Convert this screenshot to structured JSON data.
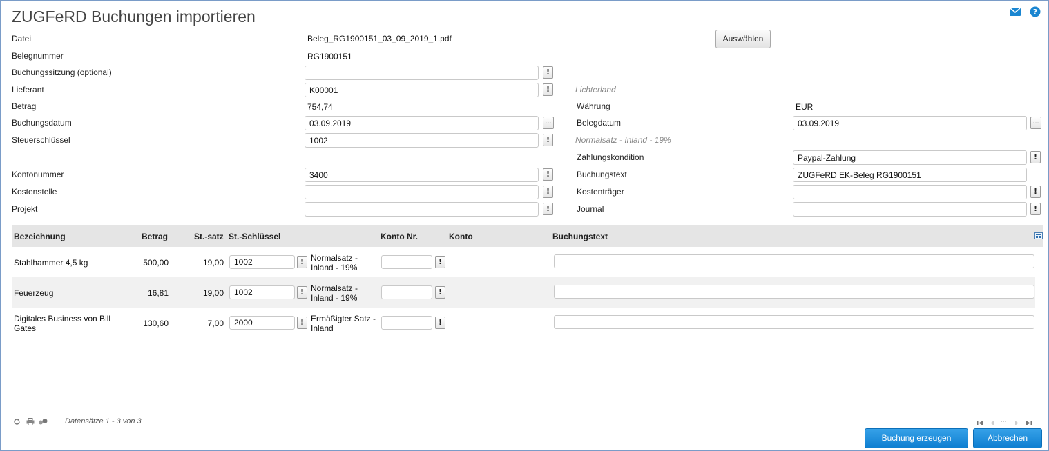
{
  "title": "ZUGFeRD Buchungen importieren",
  "icons": {
    "mail": "mail-icon",
    "help": "help-icon"
  },
  "form": {
    "datei": {
      "label": "Datei",
      "value": "Beleg_RG1900151_03_09_2019_1.pdf",
      "button": "Auswählen"
    },
    "belegnummer": {
      "label": "Belegnummer",
      "value": "RG1900151"
    },
    "buchungssitzung": {
      "label": "Buchungssitzung (optional)",
      "value": ""
    },
    "lieferant": {
      "label": "Lieferant",
      "value": "K00001",
      "hint": "Lichterland"
    },
    "betrag": {
      "label": "Betrag",
      "value": "754,74"
    },
    "waehrung": {
      "label": "Währung",
      "value": "EUR"
    },
    "buchungsdatum": {
      "label": "Buchungsdatum",
      "value": "03.09.2019",
      "picker": "..."
    },
    "belegdatum": {
      "label": "Belegdatum",
      "value": "03.09.2019",
      "picker": "..."
    },
    "steuerschluessel": {
      "label": "Steuerschlüssel",
      "value": "1002",
      "hint": "Normalsatz - Inland - 19%"
    },
    "zahlungskondition": {
      "label": "Zahlungskondition",
      "value": "Paypal-Zahlung"
    },
    "kontonummer": {
      "label": "Kontonummer",
      "value": "3400"
    },
    "buchungstext": {
      "label": "Buchungstext",
      "value": "ZUGFeRD EK-Beleg RG1900151"
    },
    "kostenstelle": {
      "label": "Kostenstelle",
      "value": ""
    },
    "kostentraeger": {
      "label": "Kostenträger",
      "value": ""
    },
    "projekt": {
      "label": "Projekt",
      "value": ""
    },
    "journal": {
      "label": "Journal",
      "value": ""
    },
    "lookup_symbol": "!"
  },
  "table": {
    "columns": [
      "Bezeichnung",
      "Betrag",
      "St.-satz",
      "St.-Schlüssel",
      "Konto Nr.",
      "Konto",
      "Buchungstext"
    ],
    "rows": [
      {
        "bezeichnung": "Stahlhammer 4,5 kg",
        "betrag": "500,00",
        "satz": "19,00",
        "schluessel": "1002",
        "schluessel_text": "Normalsatz - Inland - 19%",
        "konto_nr": "",
        "buchungstext": ""
      },
      {
        "bezeichnung": "Feuerzeug",
        "betrag": "16,81",
        "satz": "19,00",
        "schluessel": "1002",
        "schluessel_text": "Normalsatz - Inland - 19%",
        "konto_nr": "",
        "buchungstext": ""
      },
      {
        "bezeichnung": "Digitales Business von Bill Gates",
        "betrag": "130,60",
        "satz": "7,00",
        "schluessel": "2000",
        "schluessel_text": "Ermäßigter Satz - Inland",
        "konto_nr": "",
        "buchungstext": ""
      }
    ]
  },
  "footer": {
    "records": "Datensätze 1 - 3 von 3",
    "pager_ellipsis": "...",
    "create_button": "Buchung erzeugen",
    "cancel_button": "Abbrechen"
  }
}
